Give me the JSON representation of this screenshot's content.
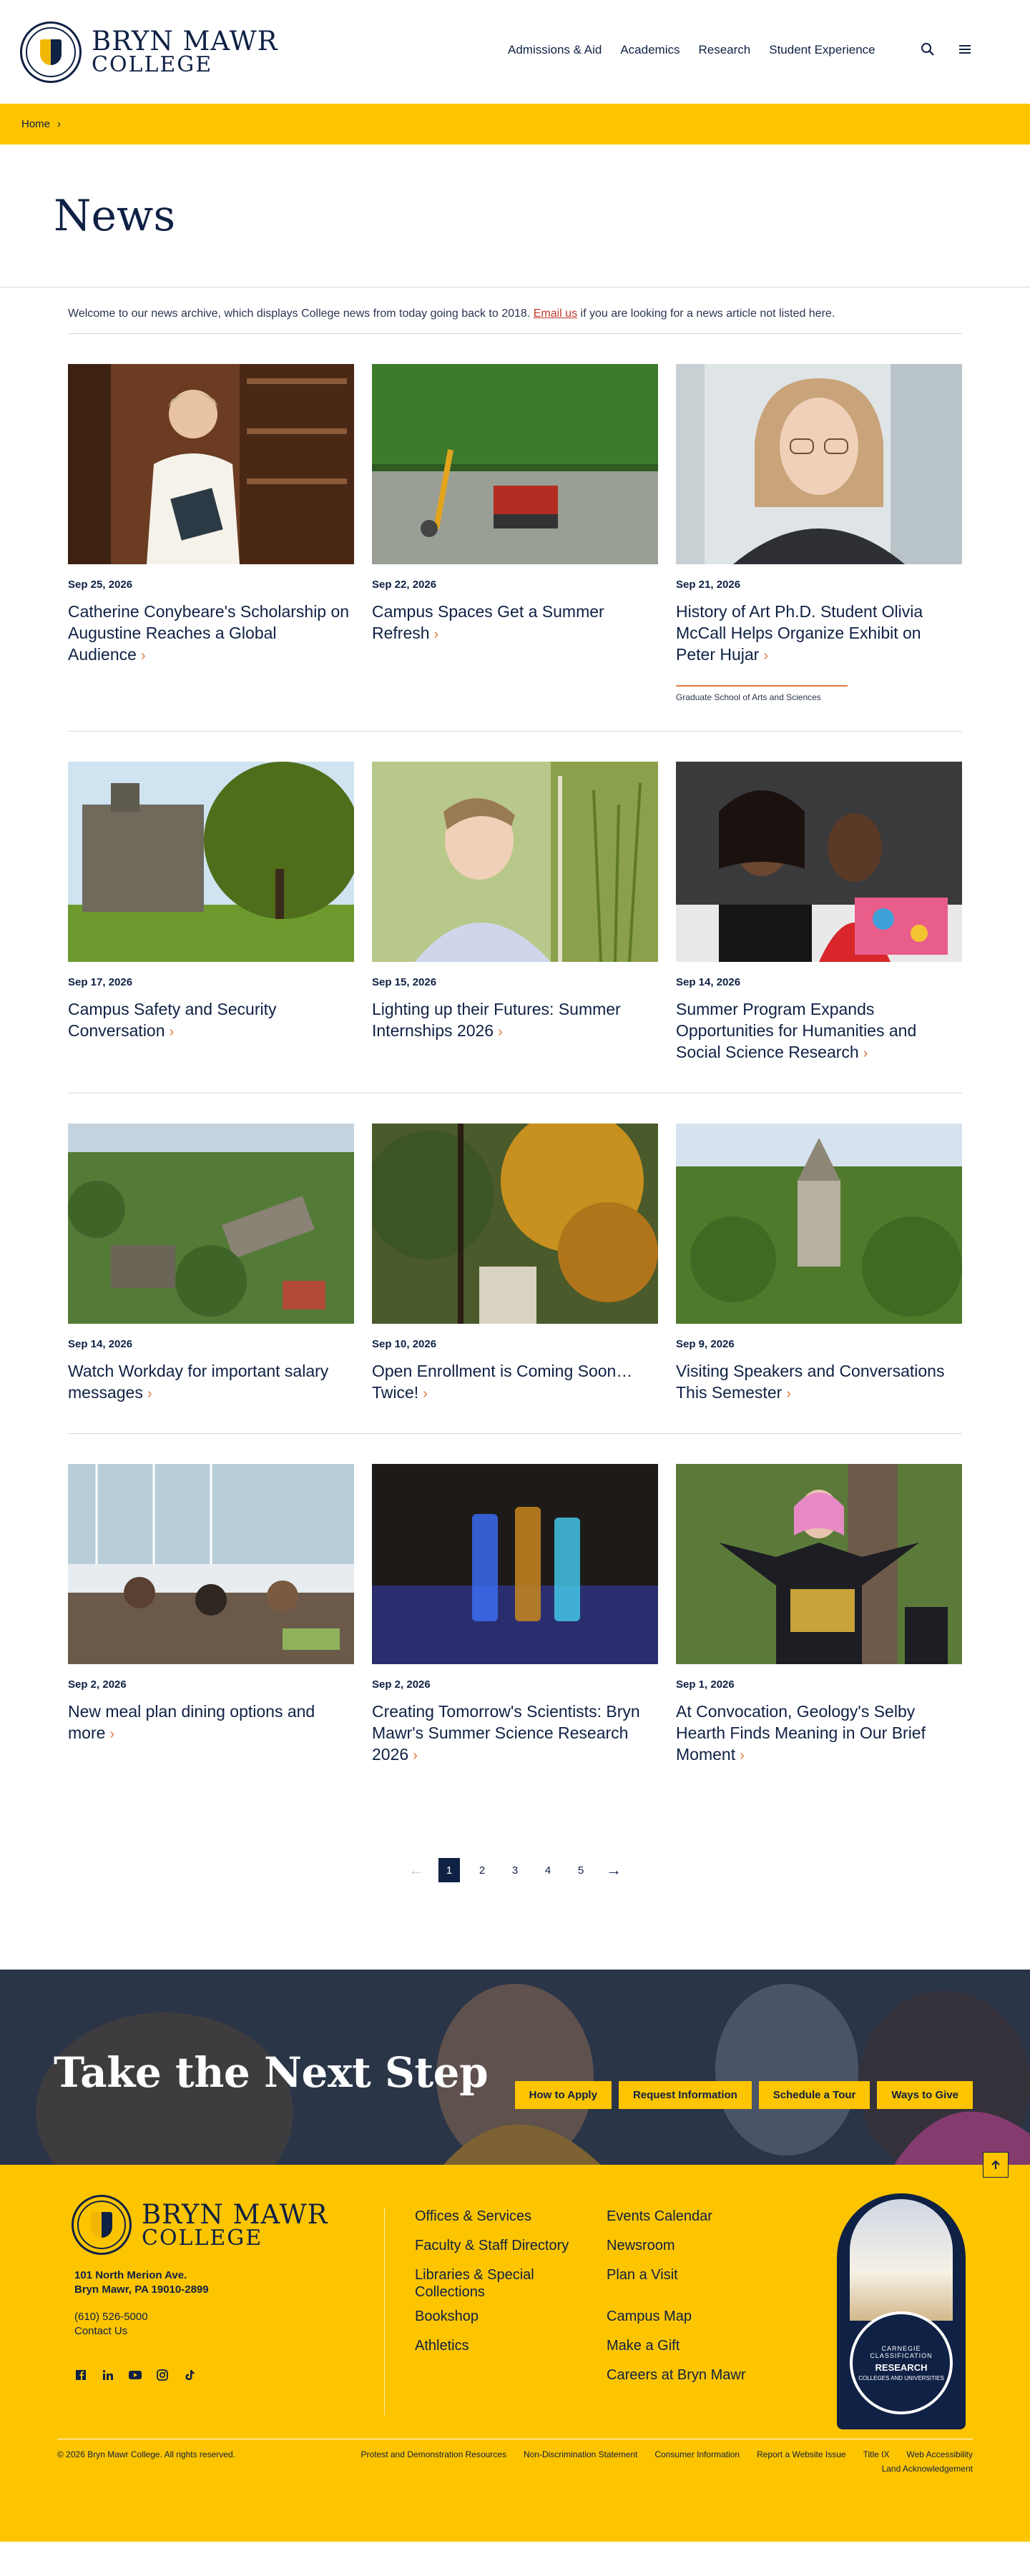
{
  "header": {
    "brand_name": "BRYN MAWR",
    "brand_sub": "COLLEGE",
    "nav": [
      "Admissions & Aid",
      "Academics",
      "Research",
      "Student Experience"
    ],
    "icons": [
      "search-icon",
      "menu-icon"
    ]
  },
  "breadcrumb": {
    "home": "Home"
  },
  "page": {
    "title": "News",
    "intro_before": "Welcome to our news archive, which displays College news from today going back to 2018.",
    "intro_link": "Email us",
    "intro_after": "if you are looking for a news article not listed here."
  },
  "news": [
    {
      "date": "Sep 25, 2026",
      "title": "Catherine Conybeare's Scholarship on Augustine Reaches a Global Audience",
      "tag": ""
    },
    {
      "date": "Sep 22, 2026",
      "title": "Campus Spaces Get a Summer Refresh",
      "tag": ""
    },
    {
      "date": "Sep 21, 2026",
      "title": "History of Art Ph.D. Student Olivia McCall Helps Organize Exhibit on Peter Hujar",
      "tag": "Graduate School of Arts and Sciences"
    },
    {
      "date": "Sep 17, 2026",
      "title": "Campus Safety and Security Conversation",
      "tag": ""
    },
    {
      "date": "Sep 15, 2026",
      "title": "Lighting up their Futures: Summer Internships 2026",
      "tag": ""
    },
    {
      "date": "Sep 14, 2026",
      "title": "Summer Program Expands Opportunities for Humanities and Social Science Research",
      "tag": ""
    },
    {
      "date": "Sep 14, 2026",
      "title": "Watch Workday for important salary messages",
      "tag": ""
    },
    {
      "date": "Sep 10, 2026",
      "title": "Open Enrollment is Coming Soon…Twice!",
      "tag": ""
    },
    {
      "date": "Sep 9, 2026",
      "title": "Visiting Speakers and Conversations This Semester",
      "tag": ""
    },
    {
      "date": "Sep 2, 2026",
      "title": "New meal plan dining options and more",
      "tag": ""
    },
    {
      "date": "Sep 2, 2026",
      "title": "Creating Tomorrow's Scientists: Bryn Mawr's Summer Science Research 2026",
      "tag": ""
    },
    {
      "date": "Sep 1, 2026",
      "title": "At Convocation, Geology's Selby Hearth Finds Meaning in Our Brief Moment",
      "tag": ""
    }
  ],
  "pagination": {
    "pages": [
      "1",
      "2",
      "3",
      "4",
      "5"
    ],
    "current": "1"
  },
  "cta": {
    "title": "Take the Next Step",
    "buttons": [
      "How to Apply",
      "Request Information",
      "Schedule a Tour",
      "Ways to Give"
    ]
  },
  "footer": {
    "brand_name": "BRYN MAWR",
    "brand_sub": "COLLEGE",
    "address_1": "101 North Merion Ave.",
    "address_2": "Bryn Mawr, PA 19010-2899",
    "phone": "(610) 526-5000",
    "contact": "Contact Us",
    "social": [
      "facebook-icon",
      "linkedin-icon",
      "youtube-icon",
      "instagram-icon",
      "tiktok-icon"
    ],
    "links_col1": [
      "Offices & Services",
      "Faculty & Staff Directory",
      "Libraries & Special Collections",
      "Bookshop",
      "Athletics"
    ],
    "links_col2": [
      "Events Calendar",
      "Newsroom",
      "Plan a Visit",
      "Campus Map",
      "Make a Gift",
      "Careers at Bryn Mawr"
    ],
    "badge_line1": "CARNEGIE CLASSIFICATION",
    "badge_line2": "RESEARCH",
    "badge_line3": "COLLEGES AND UNIVERSITIES",
    "copyright": "© 2026 Bryn Mawr College. All rights reserved.",
    "legal": [
      "Protest and Demonstration Resources",
      "Non-Discrimination Statement",
      "Consumer Information",
      "Report a Website Issue",
      "Title IX",
      "Web Accessibility",
      "Land Acknowledgement"
    ]
  },
  "colors": {
    "navy": "#0f2144",
    "gold": "#fdc400",
    "accent": "#e07a3a",
    "link": "#c0392b"
  }
}
